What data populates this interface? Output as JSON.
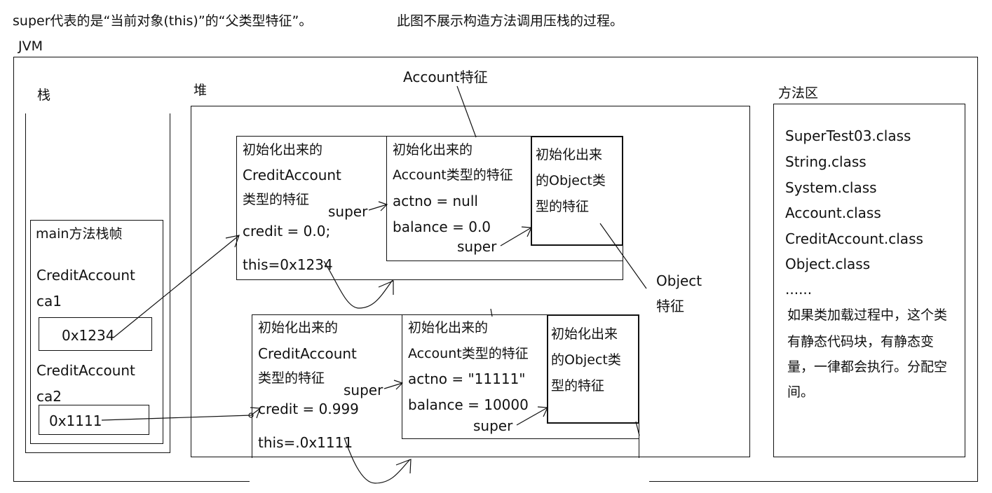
{
  "header": {
    "note1": "super代表的是“当前对象(this)”的“父类型特征”。",
    "note2": "此图不展示构造方法调用压栈的过程。"
  },
  "jvm": {
    "label": "JVM"
  },
  "stack": {
    "label": "栈",
    "frame": {
      "title": "main方法栈帧",
      "var1_type": "CreditAccount",
      "var1_name": "ca1",
      "var1_value": "0x1234",
      "var2_type": "CreditAccount",
      "var2_name": "ca2",
      "var2_value": "0x1111"
    }
  },
  "heap": {
    "label": "堆",
    "account_callout": "Account特征",
    "object_callout_line1": "Object",
    "object_callout_line2": "特征",
    "obj1": {
      "credit_part": [
        "初始化出来的",
        "CreditAccount",
        "类型的特征",
        "credit = 0.0;",
        "this=0x1234"
      ],
      "account_part": [
        "初始化出来的",
        "Account类型的特征",
        "actno = null",
        "balance = 0.0"
      ],
      "object_part": [
        "初始化出来",
        "的Object类",
        "型的特征"
      ],
      "super1": "super",
      "super2": "super"
    },
    "obj2": {
      "credit_part": [
        "初始化出来的",
        "CreditAccount",
        "类型的特征",
        "credit = 0.999",
        "this=.0x1111"
      ],
      "account_part": [
        "初始化出来的",
        "Account类型的特征",
        "actno = \"11111\"",
        "balance = 10000"
      ],
      "object_part": [
        "初始化出来",
        "的Object类",
        "型的特征"
      ],
      "super1": "super",
      "super2": "super"
    }
  },
  "method_area": {
    "label": "方法区",
    "classes": [
      "SuperTest03.class",
      "String.class",
      "System.class",
      "Account.class",
      "CreditAccount.class",
      "Object.class",
      "......"
    ],
    "note": [
      "如果类加载过程中，这个类",
      "有静态代码块，有静态变",
      "量，一律都会执行。分配空",
      "间。"
    ]
  }
}
